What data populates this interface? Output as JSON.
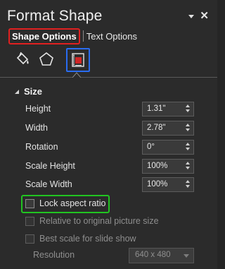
{
  "pane": {
    "title": "Format Shape"
  },
  "tabs": {
    "shape_options": "Shape Options",
    "text_options": "Text Options"
  },
  "icons": {
    "fill_line": "paint-bucket-icon",
    "effects": "pentagon-icon",
    "size_properties": "size-properties-icon"
  },
  "section": {
    "size_label": "Size"
  },
  "fields": [
    {
      "label": "Height",
      "value": "1.31\""
    },
    {
      "label": "Width",
      "value": "2.78\""
    },
    {
      "label": "Rotation",
      "value": "0°"
    },
    {
      "label": "Scale Height",
      "value": "100%"
    },
    {
      "label": "Scale Width",
      "value": "100%"
    }
  ],
  "checkboxes": {
    "lock_aspect": "Lock aspect ratio",
    "relative_original": "Relative to original picture size",
    "best_scale": "Best scale for slide show"
  },
  "resolution": {
    "label": "Resolution",
    "value": "640 x 480"
  },
  "colors": {
    "tab_highlight": "#e02020",
    "icon_highlight": "#2a6cf0",
    "checkbox_highlight": "#21c421"
  }
}
